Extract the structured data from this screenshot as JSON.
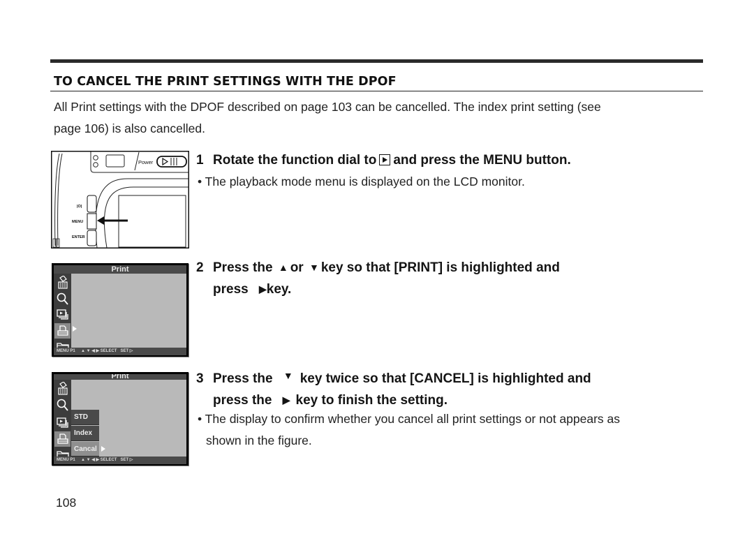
{
  "section": {
    "title": "TO CANCEL THE PRINT SETTINGS WITH THE DPOF",
    "intro_line1": "All Print settings with the DPOF described on page 103 can be cancelled. The index print setting (see",
    "intro_line2": "page 106) is also cancelled."
  },
  "steps": [
    {
      "number": "1",
      "text_a": "Rotate the function dial to",
      "icon": "playback-mode-icon",
      "text_b": "and press the MENU button.",
      "bullet": "• The playback mode menu is displayed on the LCD monitor."
    },
    {
      "number": "2",
      "line1_a": "Press the",
      "up_glyph": "▲",
      "line1_b": "or",
      "down_glyph": "▼",
      "line1_c": "key so that [PRINT] is highlighted and",
      "line2_a": "press",
      "right_glyph": "▶",
      "line2_b": "key."
    },
    {
      "number": "3",
      "line1_a": "Press the",
      "down_glyph": "▼",
      "line1_b": "key twice so that [CANCEL] is highlighted and",
      "line2_a": "press the",
      "right_glyph": "▶",
      "line2_b": "key to finish the setting.",
      "bullet_line1": "• The display to confirm whether you cancel all print settings or not appears as",
      "bullet_line2": "shown in the figure."
    }
  ],
  "camera_figure": {
    "power_label": "Power",
    "button_labels": [
      "|O|",
      "MENU",
      "ENTER"
    ]
  },
  "lcd_screens": [
    {
      "header": "Print",
      "footer": "MENU P1     ▲ ▼ ◀ ▶ SELECT   SET ▷",
      "selected_icon": "print-icon"
    },
    {
      "header": "Print",
      "footer": "MENU P1     ▲ ▼ ◀ ▶ SELECT   SET ▷",
      "submenu": [
        "STD",
        "Index",
        "Cancal"
      ],
      "selected_submenu": "Cancal"
    }
  ],
  "page_number": "108"
}
